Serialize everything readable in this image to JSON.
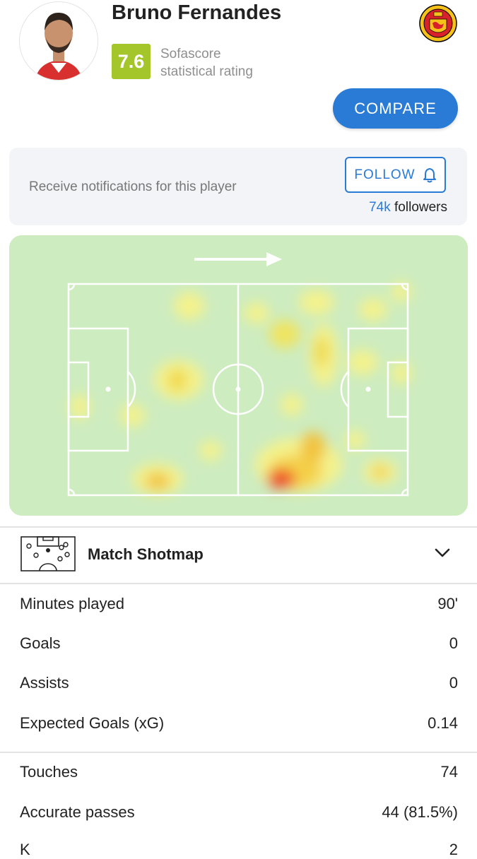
{
  "player": {
    "name": "Bruno Fernandes",
    "rating": "7.6",
    "rating_caption_line1": "Sofascore",
    "rating_caption_line2": "statistical rating",
    "club_logo_text": "MANCHESTER UNITED",
    "rating_color": "#a5c62b"
  },
  "actions": {
    "compare_label": "COMPARE"
  },
  "notifications": {
    "text": "Receive notifications for this player",
    "follow_label": "FOLLOW",
    "followers_count": "74k",
    "followers_label": " followers"
  },
  "heatmap": {
    "direction": "attacking-right",
    "pitch_color": "#cdecc0",
    "line_color": "#ffffff"
  },
  "shotmap": {
    "title": "Match Shotmap",
    "icon": "pitch-icon",
    "toggle_icon": "chevron-down-icon"
  },
  "stats": {
    "group1": [
      {
        "label": "Minutes played",
        "value": "90'"
      },
      {
        "label": "Goals",
        "value": "0"
      },
      {
        "label": "Assists",
        "value": "0"
      },
      {
        "label": "Expected Goals (xG)",
        "value": "0.14"
      }
    ],
    "group2": [
      {
        "label": "Touches",
        "value": "74"
      },
      {
        "label": "Accurate passes",
        "value": "44 (81.5%)"
      },
      {
        "label": "K",
        "value": "2"
      }
    ]
  },
  "colors": {
    "accent": "#2a7bd6",
    "text": "#222222",
    "muted": "#777777"
  }
}
